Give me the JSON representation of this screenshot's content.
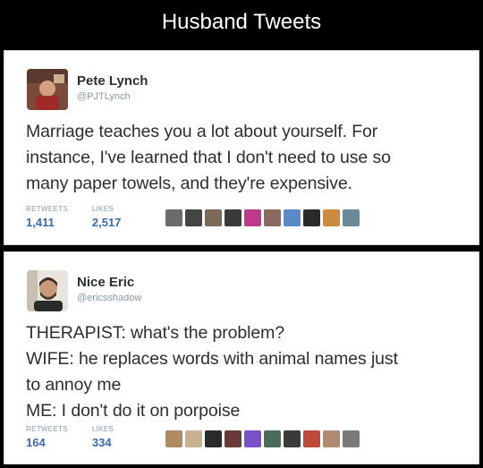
{
  "page": {
    "title": "Husband Tweets"
  },
  "tweets": [
    {
      "name": "Pete Lynch",
      "handle": "@PJTLynch",
      "lines": [
        "Marriage teaches you a lot about yourself. For",
        "instance, I've learned that I don't need to use so",
        "many paper towels, and they're expensive."
      ],
      "retweets_label": "RETWEETS",
      "retweets": "1,411",
      "likes_label": "LIKES",
      "likes": "2,517",
      "liker_colors": [
        "#6b6b6b",
        "#444444",
        "#7a6a5a",
        "#3a3a3a",
        "#c03a8a",
        "#8a6a60",
        "#5a8ac8",
        "#2a2a2a",
        "#d08a40",
        "#6a8a9a"
      ]
    },
    {
      "name": "Nice Eric",
      "handle": "@ericsshadow",
      "lines": [
        "THERAPIST: what's the problem?",
        "WIFE: he replaces words with animal names just",
        "to annoy me",
        "ME: I don't do it on porpoise"
      ],
      "retweets_label": "RETWEETS",
      "retweets": "164",
      "likes_label": "LIKES",
      "likes": "334",
      "liker_colors": [
        "#b08a60",
        "#c8b090",
        "#2a2a2a",
        "#6a3a3a",
        "#7a50c8",
        "#4a6a5a",
        "#3a3a3a",
        "#c04a3a",
        "#b08a70",
        "#7a7a7a"
      ]
    }
  ],
  "accent_color": "#3b6bb0"
}
